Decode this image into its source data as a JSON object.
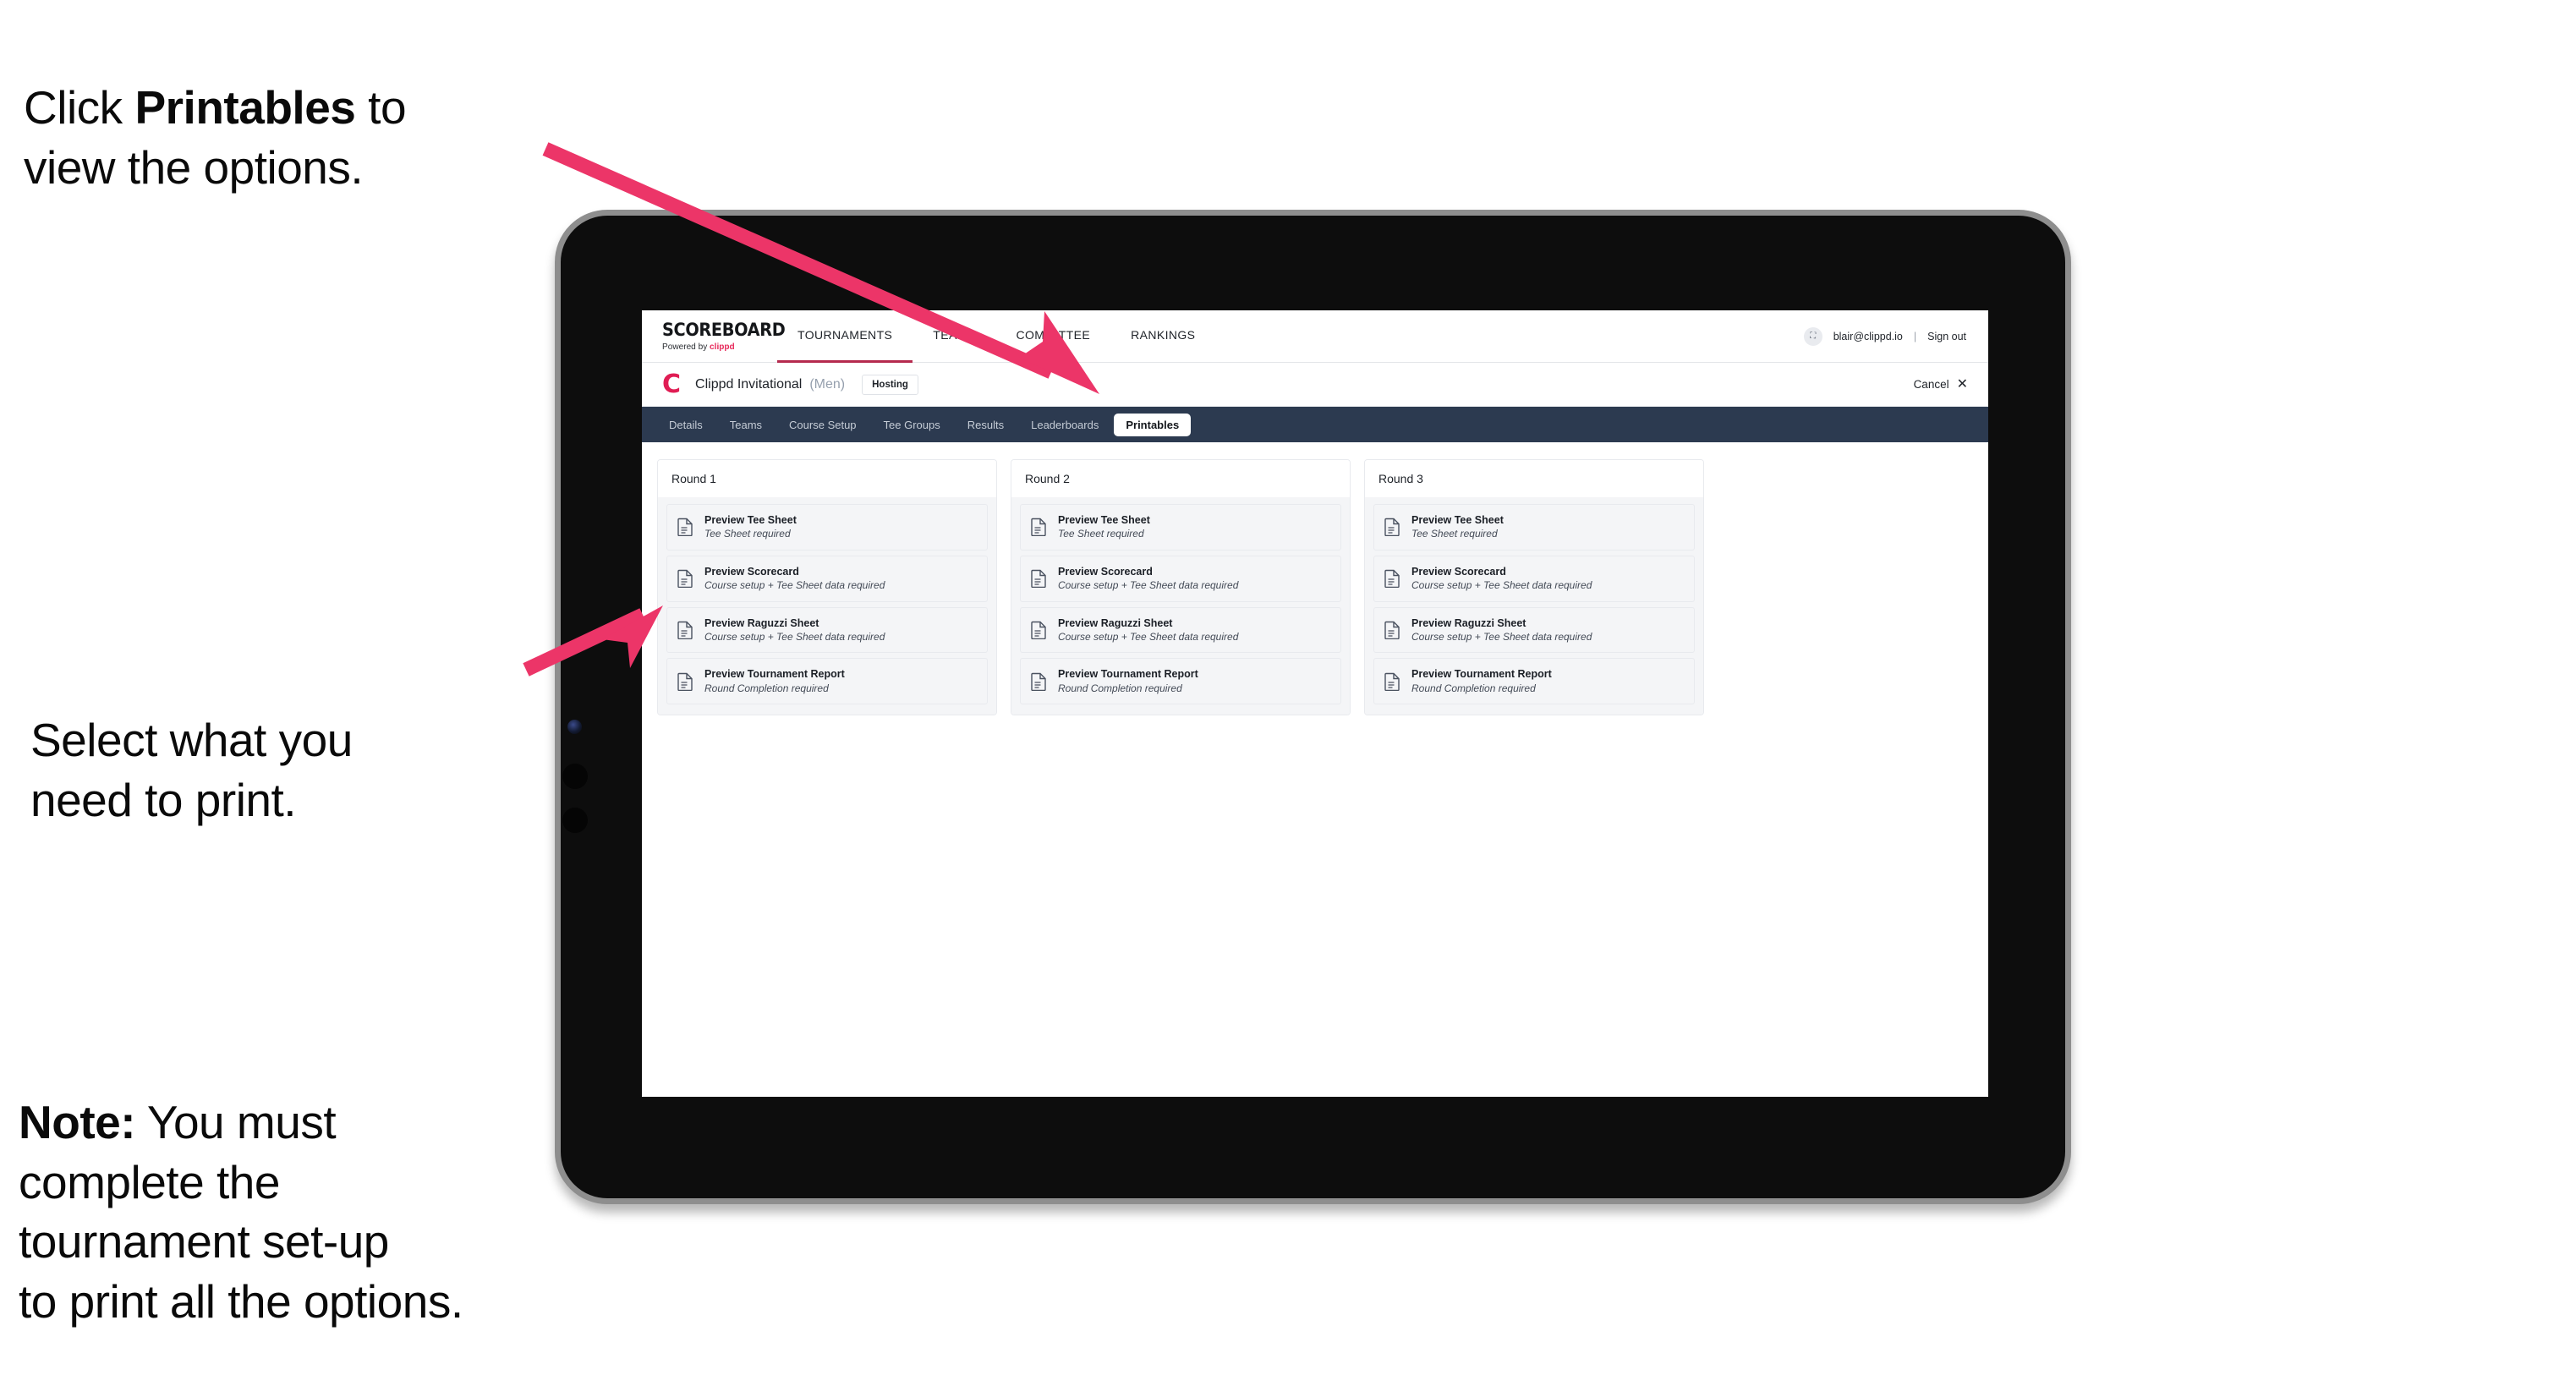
{
  "annotations": {
    "accent_color": "#ec3568",
    "captions": [
      {
        "id": "cap-1",
        "prefix": "Click ",
        "bold": "Printables",
        "suffix": " to\nview the options."
      },
      {
        "id": "cap-2",
        "prefix": "",
        "bold": "",
        "suffix": "Select what you\n need to print."
      },
      {
        "id": "cap-3",
        "prefix": "",
        "bold": "Note:",
        "suffix": " You must\ncomplete the\ntournament set-up\nto print all the options."
      }
    ]
  },
  "app": {
    "logo": {
      "wordmark": "SCOREBOARD",
      "powered_prefix": "Powered by ",
      "powered_brand": "clippd"
    },
    "main_nav": [
      {
        "label": "TOURNAMENTS",
        "active": true
      },
      {
        "label": "TEAMS",
        "active": false
      },
      {
        "label": "COMMITTEE",
        "active": false
      },
      {
        "label": "RANKINGS",
        "active": false
      }
    ],
    "user": {
      "avatar_glyph": "⛶",
      "email": "blair@clippd.io",
      "separator": "|",
      "sign_out_label": "Sign out"
    },
    "tournament_header": {
      "brand_mark": "C",
      "name": "Clippd Invitational",
      "gender": "(Men)",
      "badge": "Hosting",
      "cancel_label": "Cancel",
      "cancel_icon": "✕"
    },
    "sub_nav": [
      {
        "label": "Details",
        "active": false
      },
      {
        "label": "Teams",
        "active": false
      },
      {
        "label": "Course Setup",
        "active": false
      },
      {
        "label": "Tee Groups",
        "active": false
      },
      {
        "label": "Results",
        "active": false
      },
      {
        "label": "Leaderboards",
        "active": false
      },
      {
        "label": "Printables",
        "active": true
      }
    ],
    "rounds": [
      {
        "title": "Round 1",
        "items": [
          {
            "icon": "document-icon",
            "title": "Preview Tee Sheet",
            "subtitle": "Tee Sheet required"
          },
          {
            "icon": "document-icon",
            "title": "Preview Scorecard",
            "subtitle": "Course setup + Tee Sheet data required"
          },
          {
            "icon": "document-icon",
            "title": "Preview Raguzzi Sheet",
            "subtitle": "Course setup + Tee Sheet data required"
          },
          {
            "icon": "document-icon",
            "title": "Preview Tournament Report",
            "subtitle": "Round Completion required"
          }
        ]
      },
      {
        "title": "Round 2",
        "items": [
          {
            "icon": "document-icon",
            "title": "Preview Tee Sheet",
            "subtitle": "Tee Sheet required"
          },
          {
            "icon": "document-icon",
            "title": "Preview Scorecard",
            "subtitle": "Course setup + Tee Sheet data required"
          },
          {
            "icon": "document-icon",
            "title": "Preview Raguzzi Sheet",
            "subtitle": "Course setup + Tee Sheet data required"
          },
          {
            "icon": "document-icon",
            "title": "Preview Tournament Report",
            "subtitle": "Round Completion required"
          }
        ]
      },
      {
        "title": "Round 3",
        "items": [
          {
            "icon": "document-icon",
            "title": "Preview Tee Sheet",
            "subtitle": "Tee Sheet required"
          },
          {
            "icon": "document-icon",
            "title": "Preview Scorecard",
            "subtitle": "Course setup + Tee Sheet data required"
          },
          {
            "icon": "document-icon",
            "title": "Preview Raguzzi Sheet",
            "subtitle": "Course setup + Tee Sheet data required"
          },
          {
            "icon": "document-icon",
            "title": "Preview Tournament Report",
            "subtitle": "Round Completion required"
          }
        ]
      }
    ]
  }
}
